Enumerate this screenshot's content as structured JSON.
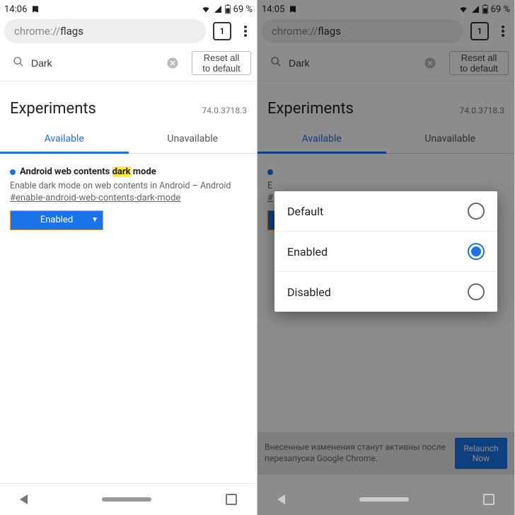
{
  "status": {
    "left_time": "14:06",
    "right_time": "14:05",
    "battery": "69 %"
  },
  "omnibox": {
    "prefix": "chrome://",
    "rest": "flags",
    "tab_count": "1"
  },
  "search": {
    "placeholder": "Search",
    "value": "Dark",
    "reset_label": "Reset all to default"
  },
  "experiments": {
    "title": "Experiments",
    "version": "74.0.3718.3",
    "tabs": {
      "available": "Available",
      "unavailable": "Unavailable"
    }
  },
  "flag": {
    "title_before": "Android web contents ",
    "highlight": "dark",
    "title_after": " mode",
    "description": "Enable dark mode on web contents in Android – Android",
    "anchor": "#enable-android-web-contents-dark-mode",
    "selected": "Enabled"
  },
  "dialog": {
    "options": [
      {
        "label": "Default",
        "selected": false
      },
      {
        "label": "Enabled",
        "selected": true
      },
      {
        "label": "Disabled",
        "selected": false
      }
    ]
  },
  "relaunch": {
    "message": "Внесенные изменения станут активны после перезапуска Google Chrome.",
    "button": "Relaunch Now"
  }
}
